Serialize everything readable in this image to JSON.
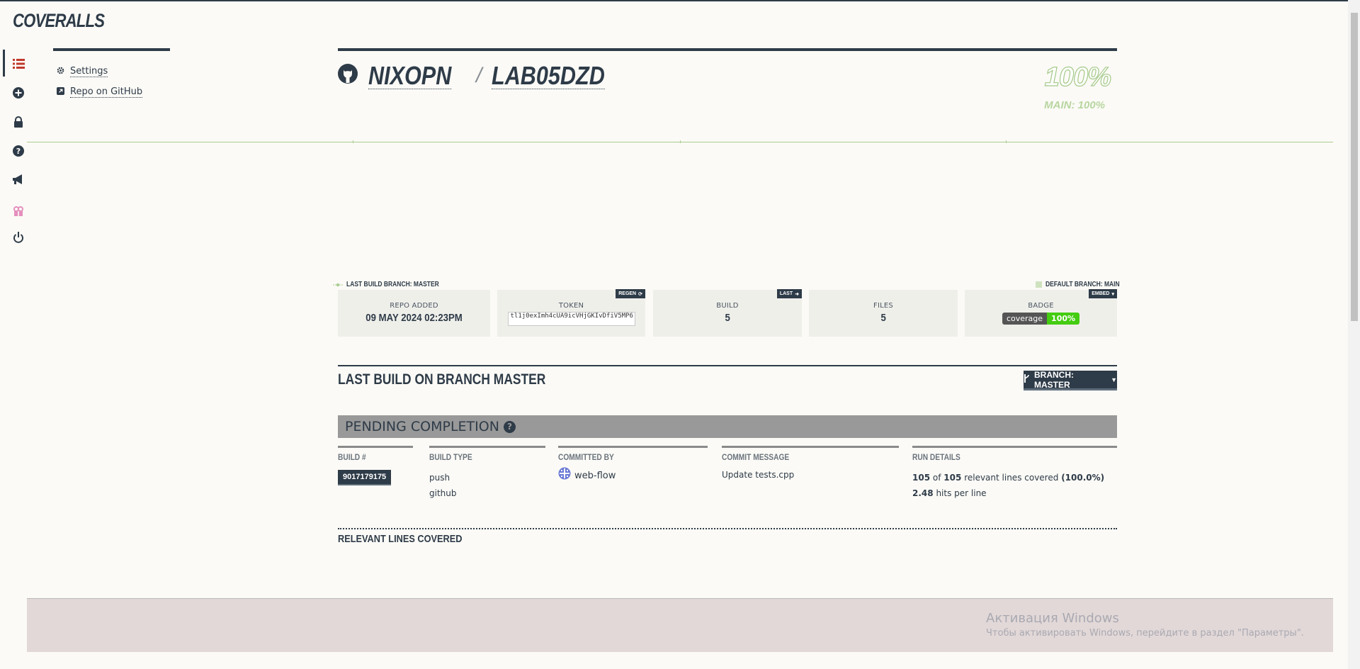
{
  "app": {
    "logo": "COVERALLS"
  },
  "sidebar_icons": [
    {
      "name": "list-icon",
      "color": "#c0392b"
    },
    {
      "name": "plus-circle-icon",
      "color": "#2e3b48"
    },
    {
      "name": "lock-icon",
      "color": "#2e3b48"
    },
    {
      "name": "question-circle-icon",
      "color": "#2e3b48"
    },
    {
      "name": "megaphone-icon",
      "color": "#2e3b48"
    },
    {
      "name": "gift-icon",
      "color": "#e58fbd"
    },
    {
      "name": "power-icon",
      "color": "#2e3b48"
    }
  ],
  "subnav": {
    "settings": "Settings",
    "repo_on_github": "Repo on GitHub"
  },
  "repo": {
    "owner": "NIXOPN",
    "separator": "/",
    "name": "LAB05DZD",
    "coverage": "100%",
    "main_coverage": "MAIN: 100%"
  },
  "build_info": {
    "last_build_branch": "LAST BUILD BRANCH: MASTER",
    "default_branch": "DEFAULT BRANCH: MAIN",
    "repo_added_label": "REPO ADDED",
    "repo_added_value": "09 MAY 2024 02:23PM",
    "token_label": "TOKEN",
    "token_value": "tl1j0exImh4cUA9icVHjGKIvDfiV5MP6",
    "regen_label": "REGEN",
    "build_label": "BUILD",
    "build_value": "5",
    "last_label": "LAST",
    "files_label": "FILES",
    "files_value": "5",
    "badge_label": "BADGE",
    "embed_label": "EMBED",
    "badge_left": "coverage",
    "badge_right": "100%"
  },
  "last_build": {
    "title": "LAST BUILD ON BRANCH MASTER",
    "branch_button": "BRANCH: MASTER",
    "status": "PENDING COMPLETION",
    "columns": {
      "build_num_head": "BUILD #",
      "build_num": "9017179175",
      "build_type_head": "BUILD TYPE",
      "build_type_1": "push",
      "build_type_2": "github",
      "committed_head": "COMMITTED BY",
      "committer": "web-flow",
      "commit_msg_head": "COMMIT MESSAGE",
      "commit_msg": "Update tests.cpp",
      "run_details_head": "RUN DETAILS",
      "covered": "105",
      "of": "of",
      "total": "105",
      "relevant_text": "relevant lines covered",
      "percent": "(100.0%)",
      "hits": "2.48",
      "hits_text": "hits per line"
    },
    "relevant_title": "RELEVANT LINES COVERED"
  },
  "watermark": {
    "title": "Активация Windows",
    "subtitle": "Чтобы активировать Windows, перейдите в раздел \"Параметры\"."
  }
}
